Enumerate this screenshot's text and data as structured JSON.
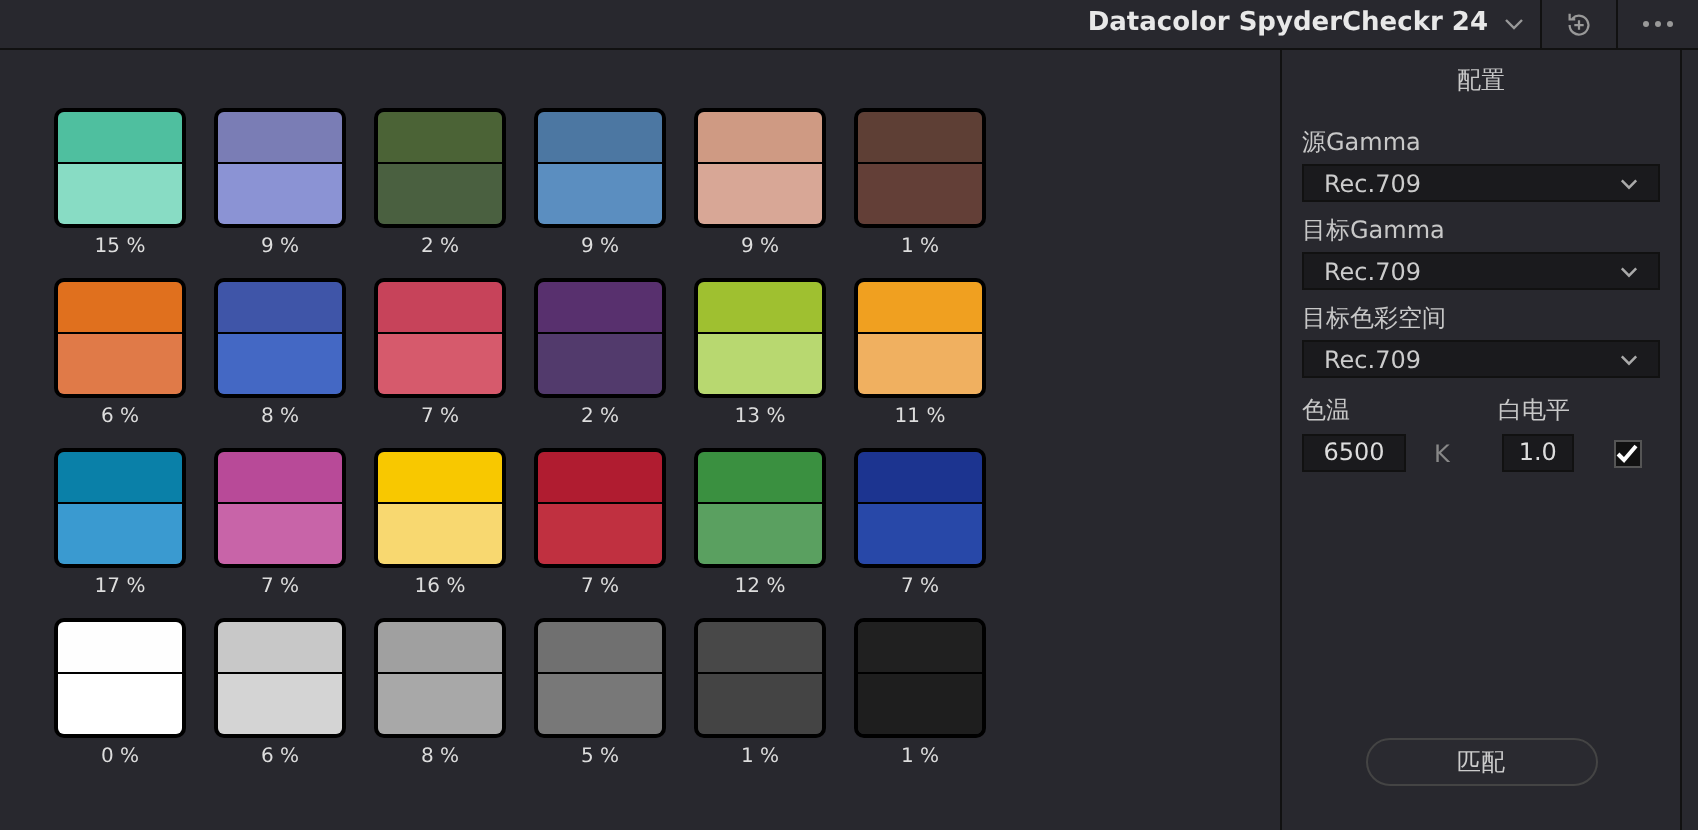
{
  "header": {
    "title": "Datacolor SpyderCheckr 24"
  },
  "patches": [
    {
      "halves": [
        {
          "color": "#4fbf9f"
        },
        {
          "color": "#88dcc4"
        }
      ],
      "reading": "15 %"
    },
    {
      "halves": [
        {
          "color": "#7a7db5"
        },
        {
          "color": "#8b93d4"
        }
      ],
      "reading": "9 %"
    },
    {
      "halves": [
        {
          "color": "#4b6336"
        },
        {
          "color": "#4a6040"
        }
      ],
      "reading": "2 %"
    },
    {
      "halves": [
        {
          "color": "#4c77a2"
        },
        {
          "color": "#5b8ec0"
        }
      ],
      "reading": "9 %"
    },
    {
      "halves": [
        {
          "color": "#cf9a83"
        },
        {
          "color": "#d8a796"
        }
      ],
      "reading": "9 %"
    },
    {
      "halves": [
        {
          "color": "#5e3f35"
        },
        {
          "color": "#633f37"
        }
      ],
      "reading": "1 %"
    },
    {
      "halves": [
        {
          "color": "#e0701e"
        },
        {
          "color": "#e07a48"
        }
      ],
      "reading": "6 %"
    },
    {
      "halves": [
        {
          "color": "#3f55a8"
        },
        {
          "color": "#4468c4"
        }
      ],
      "reading": "8 %"
    },
    {
      "halves": [
        {
          "color": "#c7435a"
        },
        {
          "color": "#d65a6c"
        }
      ],
      "reading": "7 %"
    },
    {
      "halves": [
        {
          "color": "#58306e"
        },
        {
          "color": "#523a6c"
        }
      ],
      "reading": "2 %"
    },
    {
      "halves": [
        {
          "color": "#9fc030"
        },
        {
          "color": "#b8d870"
        }
      ],
      "reading": "13 %"
    },
    {
      "halves": [
        {
          "color": "#f0a020"
        },
        {
          "color": "#f0b060"
        }
      ],
      "reading": "11 %"
    },
    {
      "halves": [
        {
          "color": "#0a80a8"
        },
        {
          "color": "#3a9ad0"
        }
      ],
      "reading": "17 %"
    },
    {
      "halves": [
        {
          "color": "#b84a98"
        },
        {
          "color": "#c864a8"
        }
      ],
      "reading": "7 %"
    },
    {
      "halves": [
        {
          "color": "#f8c800"
        },
        {
          "color": "#f8d870"
        }
      ],
      "reading": "16 %"
    },
    {
      "halves": [
        {
          "color": "#b01c30"
        },
        {
          "color": "#c03040"
        }
      ],
      "reading": "7 %"
    },
    {
      "halves": [
        {
          "color": "#3a9040"
        },
        {
          "color": "#5aa060"
        }
      ],
      "reading": "12 %"
    },
    {
      "halves": [
        {
          "color": "#1c3490"
        },
        {
          "color": "#2848a8"
        }
      ],
      "reading": "7 %"
    },
    {
      "halves": [
        {
          "color": "#fefefe"
        },
        {
          "color": "#ffffff"
        }
      ],
      "reading": "0 %"
    },
    {
      "halves": [
        {
          "color": "#c8c8c8"
        },
        {
          "color": "#d4d4d4"
        }
      ],
      "reading": "6 %"
    },
    {
      "halves": [
        {
          "color": "#a0a0a0"
        },
        {
          "color": "#a8a8a8"
        }
      ],
      "reading": "8 %"
    },
    {
      "halves": [
        {
          "color": "#707070"
        },
        {
          "color": "#787878"
        }
      ],
      "reading": "5 %"
    },
    {
      "halves": [
        {
          "color": "#484848"
        },
        {
          "color": "#444444"
        }
      ],
      "reading": "1 %"
    },
    {
      "halves": [
        {
          "color": "#202020"
        },
        {
          "color": "#1e1e1e"
        }
      ],
      "reading": "1 %"
    }
  ],
  "panel": {
    "title": "配置",
    "dropdowns": [
      {
        "label": "源Gamma",
        "value": "Rec.709"
      },
      {
        "label": "目标Gamma",
        "value": "Rec.709"
      },
      {
        "label": "目标色彩空间",
        "value": "Rec.709"
      }
    ],
    "temperature": {
      "label": "色温",
      "value": "6500",
      "unit": "K"
    },
    "white_level": {
      "label": "白电平",
      "value": "1.0",
      "checked": true
    },
    "match_button": "匹配"
  }
}
